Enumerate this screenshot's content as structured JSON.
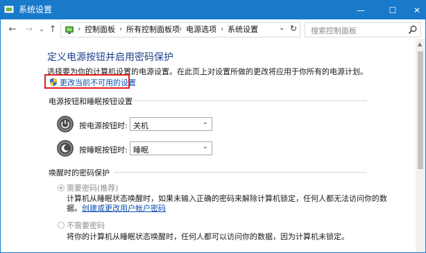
{
  "window": {
    "title": "系统设置",
    "controls": {
      "minimize": "—",
      "maximize": "☐",
      "close": "✕"
    }
  },
  "nav": {
    "back": "←",
    "forward": "→",
    "recent": "⌄",
    "up": "↑",
    "breadcrumb": [
      "控制面板",
      "所有控制面板项",
      "电源选项",
      "系统设置"
    ],
    "separator": "›",
    "dropdown": "⌄",
    "refresh": "↻",
    "search_placeholder": "搜索控制面板"
  },
  "main": {
    "title": "定义电源按钮并启用密码保护",
    "description": "选择要为你的计算机设置的电源设置。在此页上对设置所做的更改将应用于你所有的电源计划。",
    "change_link": "更改当前不可用的设置",
    "buttons_section": {
      "heading": "电源按钮和睡眠按钮设置",
      "power_label": "按电源按钮时:",
      "power_value": "关机",
      "sleep_label": "按睡眠按钮时:",
      "sleep_value": "睡眠"
    },
    "password_section": {
      "heading": "唤醒时的密码保护",
      "option1_label": "需要密码(推荐)",
      "option1_selected": true,
      "option1_desc_line1": "计算机从睡眠状态唤醒时，如果未输入正确的密码来解除计算机锁定，任何人都无法访问你的数",
      "option1_desc_line2_prefix": "据。",
      "option1_link": "创建或更改用户帐户密码",
      "option2_label": "不需要密码",
      "option2_selected": false,
      "option2_desc": "将你的计算机从睡眠状态唤醒时，任何人都可以访问你的数据，因为计算机未锁定。"
    }
  },
  "colors": {
    "titlebar": "#1979ca",
    "heading": "#1e3f8a",
    "link": "#0a4fb4",
    "highlight_border": "#e21b1b"
  },
  "icons": [
    "control-panel-icon",
    "shield-icon",
    "power-button-icon",
    "sleep-button-icon",
    "search-icon"
  ]
}
